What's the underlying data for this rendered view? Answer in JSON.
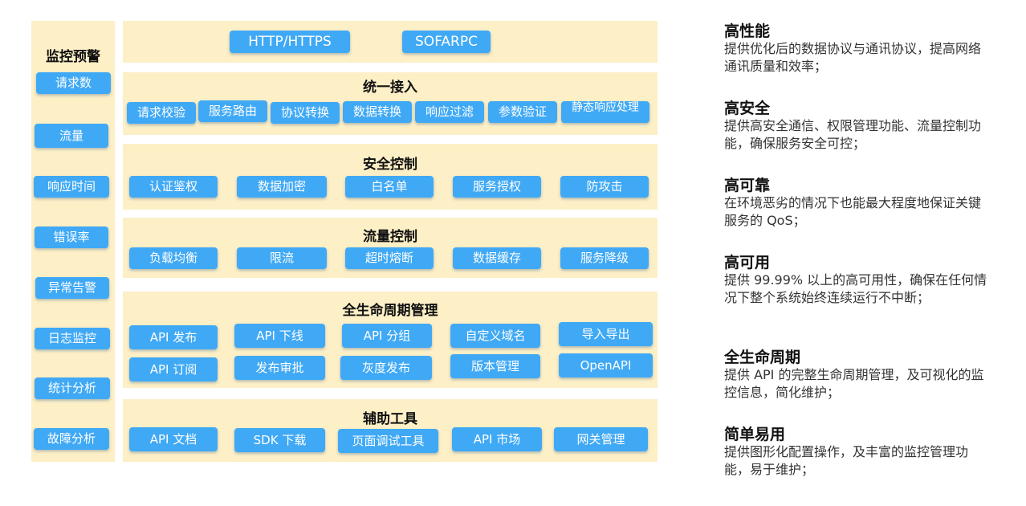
{
  "sidebar": {
    "title": "监控预警",
    "items": [
      "请求数",
      "流量",
      "响应时间",
      "错误率",
      "异常告警",
      "日志监控",
      "统计分析",
      "故障分析"
    ]
  },
  "protocols": [
    "HTTP/HTTPS",
    "SOFARPC"
  ],
  "access": {
    "title": "统一接入",
    "items": [
      "请求校验",
      "服务路由",
      "协议转换",
      "数据转换",
      "响应过滤",
      "参数验证",
      "静态响应处理"
    ]
  },
  "security": {
    "title": "安全控制",
    "items": [
      "认证鉴权",
      "数据加密",
      "白名单",
      "服务授权",
      "防攻击"
    ]
  },
  "traffic": {
    "title": "流量控制",
    "items": [
      "负载均衡",
      "限流",
      "超时熔断",
      "数据缓存",
      "服务降级"
    ]
  },
  "lifecycle": {
    "title": "全生命周期管理",
    "row1": [
      "API 发布",
      "API 下线",
      "API 分组",
      "自定义域名",
      "导入导出"
    ],
    "row2": [
      "API 订阅",
      "发布审批",
      "灰度发布",
      "版本管理",
      "OpenAPI"
    ]
  },
  "tools": {
    "title": "辅助工具",
    "items": [
      "API 文档",
      "SDK 下载",
      "页面调试工具",
      "API 市场",
      "网关管理"
    ]
  },
  "features": [
    {
      "title": "高性能",
      "desc": "提供优化后的数据协议与通讯协议，提高网络通讯质量和效率；"
    },
    {
      "title": "高安全",
      "desc": "提供高安全通信、权限管理功能、流量控制功能，确保服务安全可控；"
    },
    {
      "title": "高可靠",
      "desc": "在环境恶劣的情况下也能最大程度地保证关键服务的 QoS；"
    },
    {
      "title": "高可用",
      "desc": "提供 99.99% 以上的高可用性，确保在任何情况下整个系统始终连续运行不中断；"
    },
    {
      "title": "全生命周期",
      "desc": "提供 API 的完整生命周期管理，及可视化的监控信息，简化维护；"
    },
    {
      "title": "简单易用",
      "desc": "提供图形化配置操作，及丰富的监控管理功能，易于维护；"
    }
  ],
  "colors": {
    "panel": "#fdefc6",
    "pill": "#40a9f5",
    "pill_text": "#ffffff"
  }
}
